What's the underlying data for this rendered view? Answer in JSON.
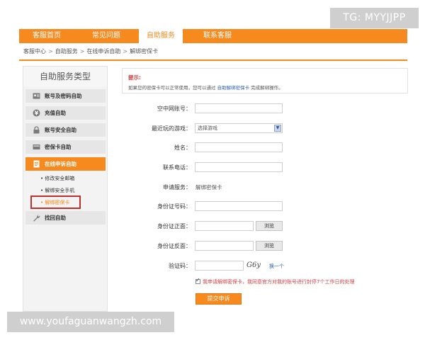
{
  "watermarks": {
    "tg": "TG: MYYJJPP",
    "url": "www.youfaguanwangzh.com"
  },
  "nav": {
    "tabs": [
      {
        "label": "客服首页"
      },
      {
        "label": "常见问题"
      },
      {
        "label": "自助服务",
        "active": true
      },
      {
        "label": "联系客服"
      }
    ]
  },
  "breadcrumb": [
    "客服中心",
    "自助服务",
    "在线申诉自助",
    "解绑密保卡"
  ],
  "breadcrumb_sep": ">",
  "sidebar": {
    "title": "自助服务类型",
    "items": [
      {
        "label": "账号及密码自助",
        "icon": "account-icon"
      },
      {
        "label": "充值自助",
        "icon": "yen-coin-icon"
      },
      {
        "label": "账号安全自助",
        "icon": "lock-icon"
      },
      {
        "label": "密保卡自助",
        "icon": "card-icon"
      },
      {
        "label": "在线申诉自助",
        "icon": "document-icon",
        "active": true
      },
      {
        "label": "找回自助",
        "icon": "wrench-icon"
      }
    ],
    "subitems": [
      {
        "label": "• 修改安全邮箱"
      },
      {
        "label": "• 解绑安全手机"
      },
      {
        "label": "• 解绑密保卡",
        "selected": true
      }
    ]
  },
  "notice": {
    "title": "提示:",
    "text_before": "如果您的密保卡可以正常使用，您可以通过",
    "link": "自助解绑密保卡",
    "text_after": "完成解绑操作。"
  },
  "form": {
    "account_label": "空中网账号：",
    "game_label": "最近玩的游戏：",
    "game_placeholder": "选择游戏",
    "name_label": "姓名：",
    "phone_label": "联系电话：",
    "service_label": "申请服务：",
    "service_value": "解绑密保卡",
    "id_label": "身份证号码：",
    "id_front_label": "身份证正面：",
    "id_back_label": "身份证反面：",
    "browse": "浏览",
    "captcha_label": "验证码：",
    "captcha_image_text": "G6y",
    "captcha_refresh": "换一个",
    "agreement": "我申请解绑密保卡，我同意官方对我的账号进行封停7个工作日的处理",
    "submit": "提交申诉"
  },
  "colors": {
    "accent": "#f68a1e",
    "highlight_box": "#c0302f",
    "link": "#2b5fb3"
  }
}
